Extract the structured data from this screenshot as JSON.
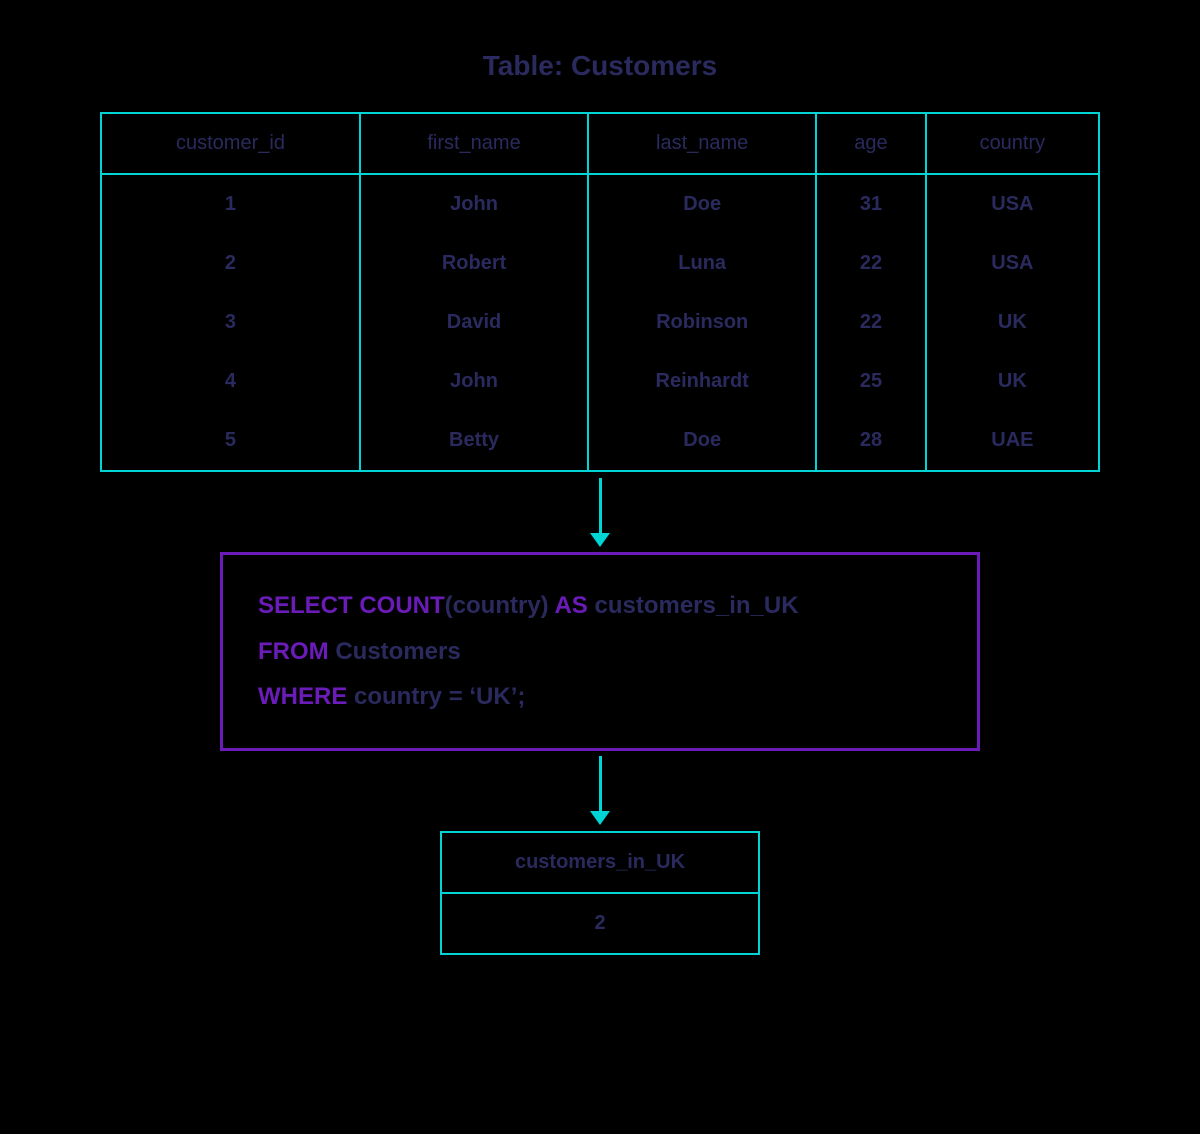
{
  "title": "Table: Customers",
  "input_table": {
    "headers": [
      "customer_id",
      "first_name",
      "last_name",
      "age",
      "country"
    ],
    "rows": [
      [
        "1",
        "John",
        "Doe",
        "31",
        "USA"
      ],
      [
        "2",
        "Robert",
        "Luna",
        "22",
        "USA"
      ],
      [
        "3",
        "David",
        "Robinson",
        "22",
        "UK"
      ],
      [
        "4",
        "John",
        "Reinhardt",
        "25",
        "UK"
      ],
      [
        "5",
        "Betty",
        "Doe",
        "28",
        "UAE"
      ]
    ]
  },
  "sql": {
    "kw_select": "SELECT COUNT",
    "tx_count_arg": "(country) ",
    "kw_as": "AS",
    "tx_alias": " customers_in_UK",
    "kw_from": "FROM",
    "tx_from": " Customers",
    "kw_where": "WHERE",
    "tx_where": " country = ‘UK’;"
  },
  "result_table": {
    "header": "customers_in_UK",
    "value": "2"
  }
}
